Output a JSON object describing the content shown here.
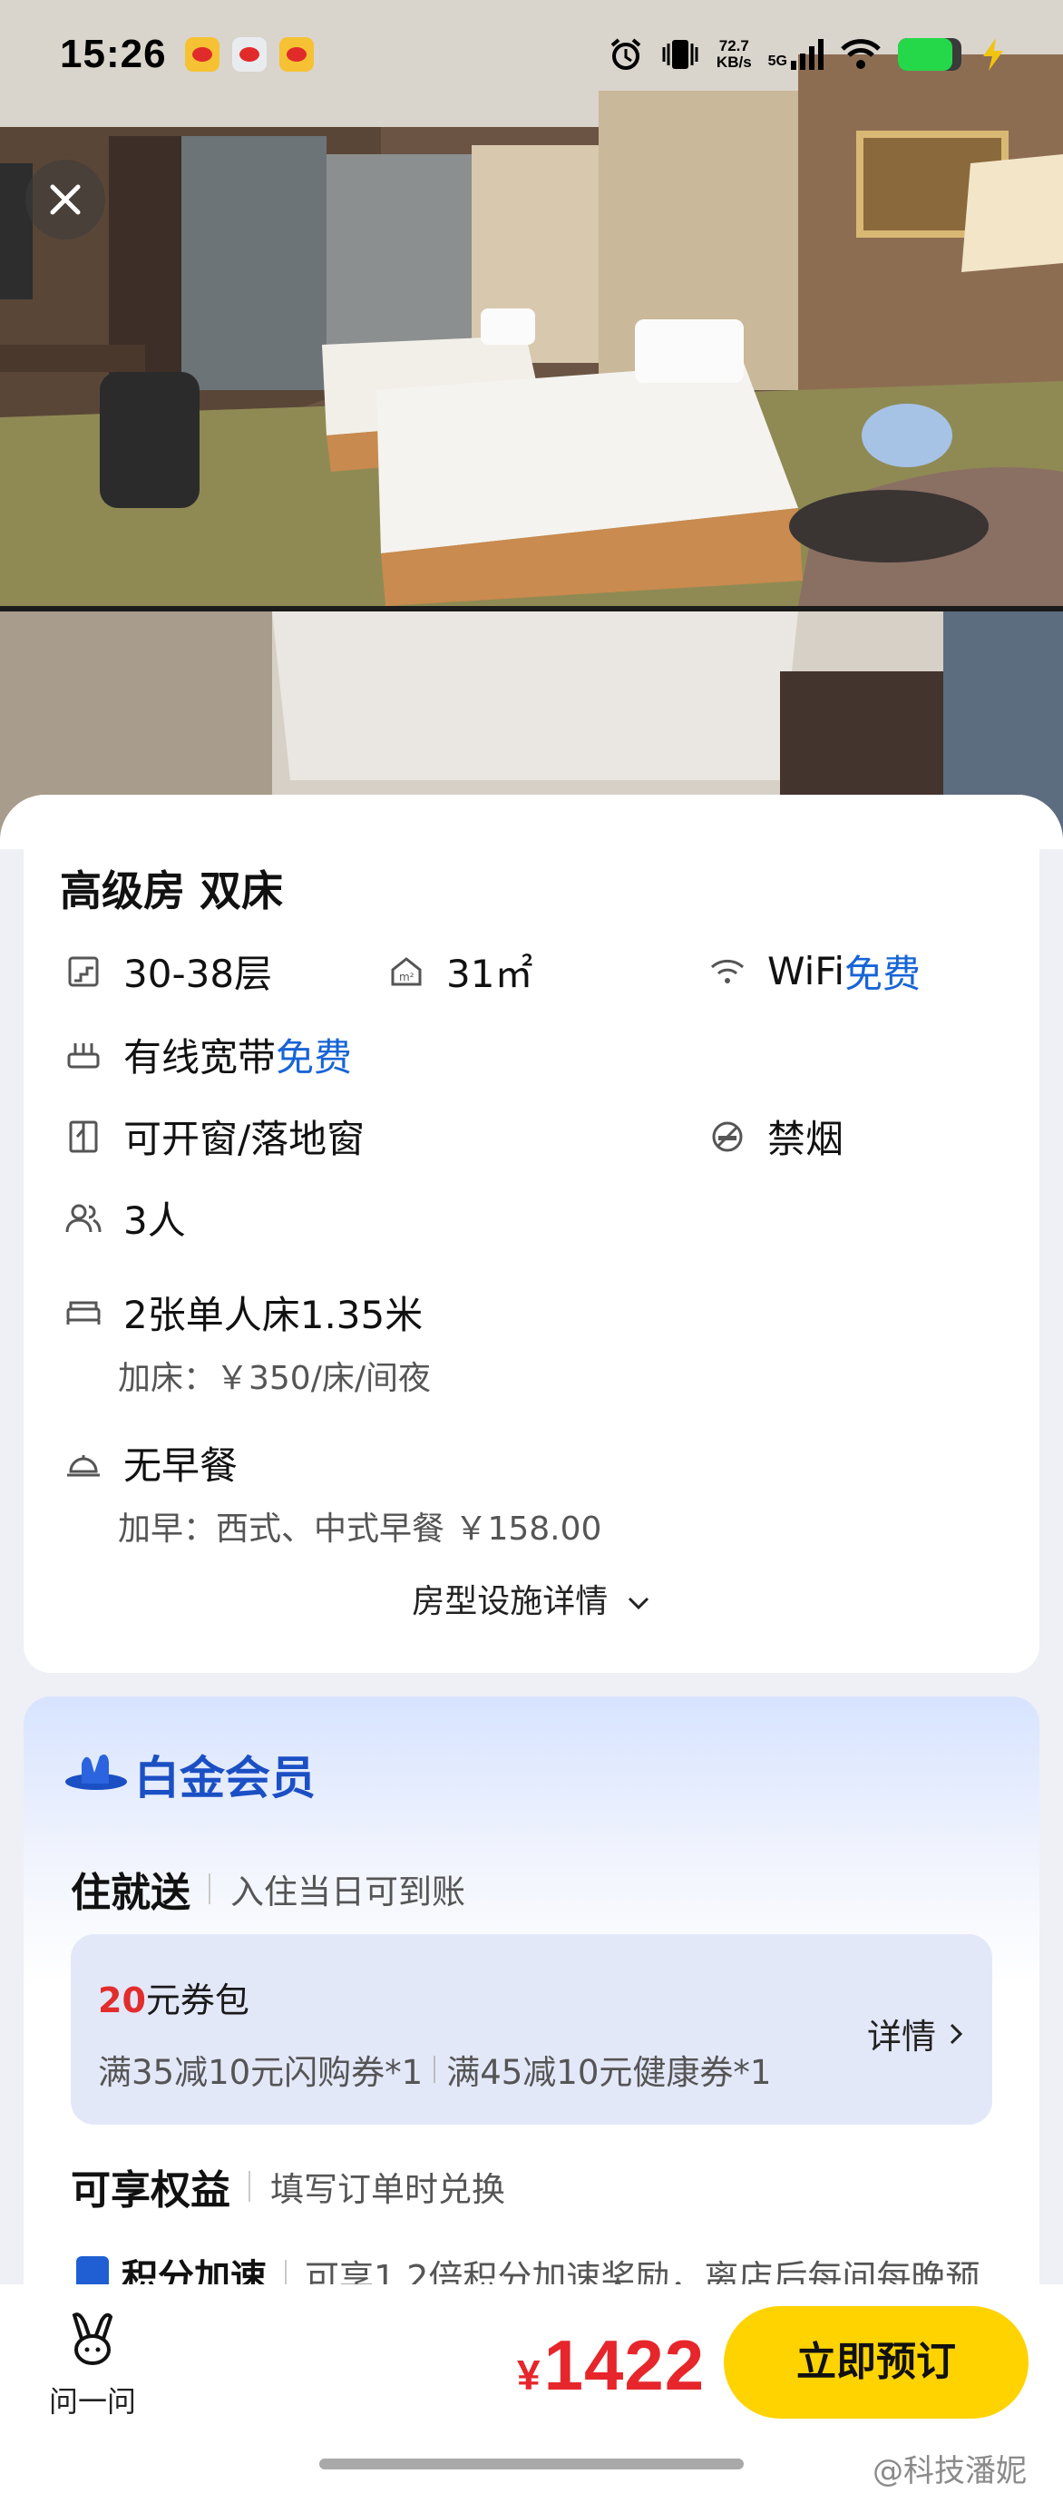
{
  "status_bar": {
    "time": "15:26",
    "net_speed_value": "72.7",
    "net_speed_unit": "KB/s",
    "network": "5G",
    "battery_level": 0.85,
    "battery_color": "#25d84a"
  },
  "room": {
    "title": "高级房 双床",
    "floor": "30-38层",
    "area": "31㎡",
    "wifi_label": "WiFi",
    "wifi_status": "免费",
    "broadband_label": "有线宽带",
    "broadband_status": "免费",
    "window": "可开窗/落地窗",
    "smoking": "禁烟",
    "occupancy": "3人",
    "beds": "2张单人床1.35米",
    "extra_bed": "加床：￥350/床/间夜",
    "breakfast": "无早餐",
    "extra_breakfast": "加早：西式、中式早餐 ￥158.00",
    "more_label": "房型设施详情"
  },
  "membership": {
    "tier": "白金会员",
    "stay_gift_label": "住就送",
    "stay_gift_note": "入住当日可到账",
    "coupon_amount": "20",
    "coupon_suffix": "元券包",
    "coupon_item_1": "满35减10元闪购券*1",
    "coupon_item_2": "满45减10元健康券*1",
    "coupon_detail": "详情",
    "benefits_label": "可享权益",
    "benefits_note": "填写订单时兑换",
    "accel_label": "积分加速",
    "accel_note": "可享1.2倍积分加速奖励，离店后每间每晚预"
  },
  "bottom_bar": {
    "ask_label": "问一问",
    "currency": "¥",
    "price": "1422",
    "book_label": "立即预订",
    "price_color": "#e6262b",
    "book_color": "#ffd300"
  },
  "watermark": "@科技潘妮",
  "colors": {
    "accent_blue": "#1764d6",
    "member_blue": "#1b4fc4"
  }
}
